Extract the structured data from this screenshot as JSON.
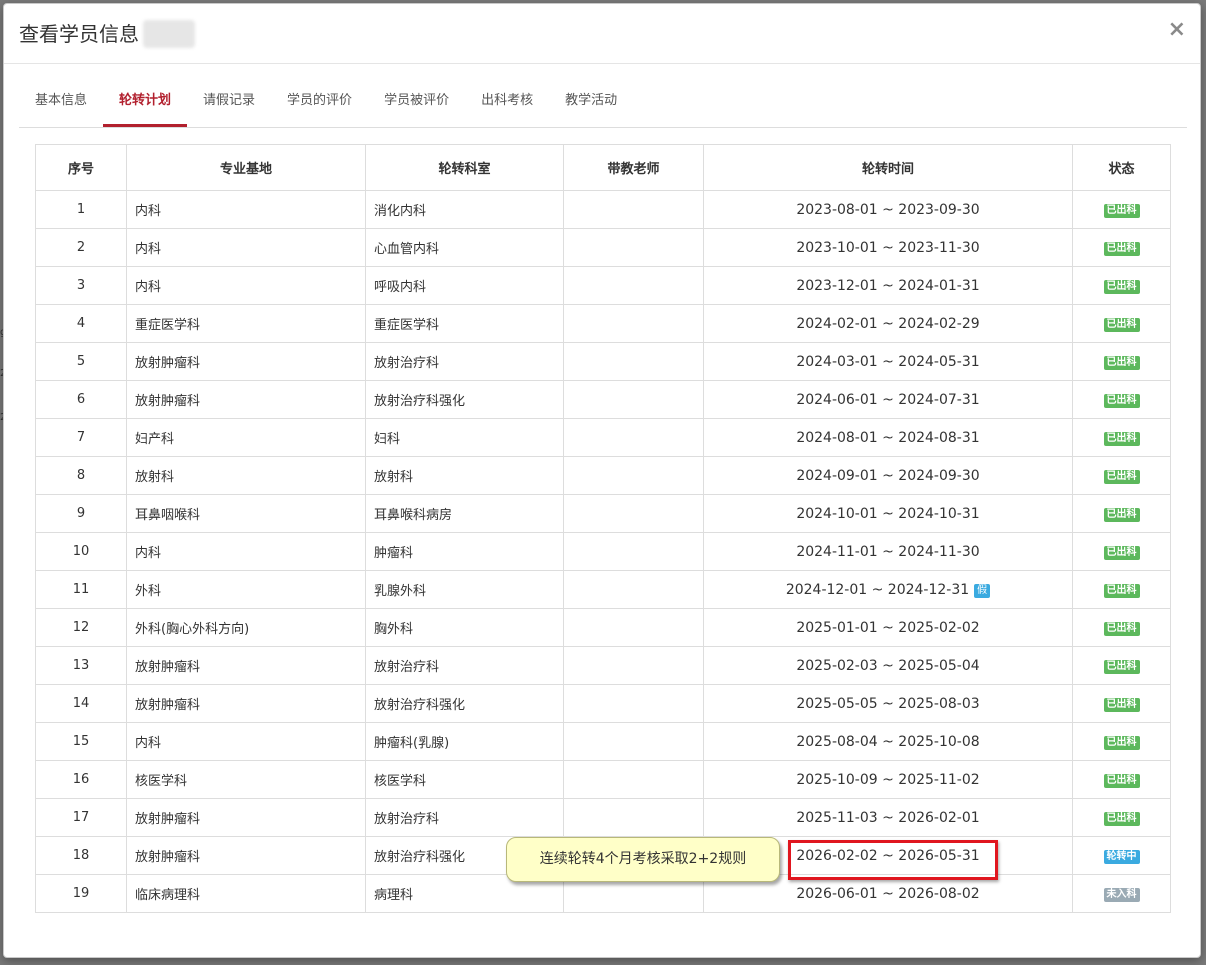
{
  "dialog": {
    "title": "查看学员信息",
    "close_label": "×"
  },
  "tabs": [
    {
      "label": "基本信息",
      "active": false
    },
    {
      "label": "轮转计划",
      "active": true
    },
    {
      "label": "请假记录",
      "active": false
    },
    {
      "label": "学员的评价",
      "active": false
    },
    {
      "label": "学员被评价",
      "active": false
    },
    {
      "label": "出科考核",
      "active": false
    },
    {
      "label": "教学活动",
      "active": false
    }
  ],
  "table": {
    "headers": [
      "序号",
      "专业基地",
      "轮转科室",
      "带教老师",
      "轮转时间",
      "状态"
    ],
    "rows": [
      {
        "no": "1",
        "base": "内科",
        "dept": "消化内科",
        "teacher": "",
        "time": "2023-08-01 ~ 2023-09-30",
        "status": "已出科",
        "leave": ""
      },
      {
        "no": "2",
        "base": "内科",
        "dept": "心血管内科",
        "teacher": "",
        "time": "2023-10-01 ~ 2023-11-30",
        "status": "已出科",
        "leave": ""
      },
      {
        "no": "3",
        "base": "内科",
        "dept": "呼吸内科",
        "teacher": "",
        "time": "2023-12-01 ~ 2024-01-31",
        "status": "已出科",
        "leave": ""
      },
      {
        "no": "4",
        "base": "重症医学科",
        "dept": "重症医学科",
        "teacher": "",
        "time": "2024-02-01 ~ 2024-02-29",
        "status": "已出科",
        "leave": ""
      },
      {
        "no": "5",
        "base": "放射肿瘤科",
        "dept": "放射治疗科",
        "teacher": "",
        "time": "2024-03-01 ~ 2024-05-31",
        "status": "已出科",
        "leave": ""
      },
      {
        "no": "6",
        "base": "放射肿瘤科",
        "dept": "放射治疗科强化",
        "teacher": "",
        "time": "2024-06-01 ~ 2024-07-31",
        "status": "已出科",
        "leave": ""
      },
      {
        "no": "7",
        "base": "妇产科",
        "dept": "妇科",
        "teacher": "",
        "time": "2024-08-01 ~ 2024-08-31",
        "status": "已出科",
        "leave": ""
      },
      {
        "no": "8",
        "base": "放射科",
        "dept": "放射科",
        "teacher": "",
        "time": "2024-09-01 ~ 2024-09-30",
        "status": "已出科",
        "leave": ""
      },
      {
        "no": "9",
        "base": "耳鼻咽喉科",
        "dept": "耳鼻喉科病房",
        "teacher": "",
        "time": "2024-10-01 ~ 2024-10-31",
        "status": "已出科",
        "leave": ""
      },
      {
        "no": "10",
        "base": "内科",
        "dept": "肿瘤科",
        "teacher": "",
        "time": "2024-11-01 ~ 2024-11-30",
        "status": "已出科",
        "leave": ""
      },
      {
        "no": "11",
        "base": "外科",
        "dept": "乳腺外科",
        "teacher": "",
        "time": "2024-12-01 ~ 2024-12-31",
        "status": "已出科",
        "leave": "假"
      },
      {
        "no": "12",
        "base": "外科(胸心外科方向)",
        "dept": "胸外科",
        "teacher": "",
        "time": "2025-01-01 ~ 2025-02-02",
        "status": "已出科",
        "leave": ""
      },
      {
        "no": "13",
        "base": "放射肿瘤科",
        "dept": "放射治疗科",
        "teacher": "",
        "time": "2025-02-03 ~ 2025-05-04",
        "status": "已出科",
        "leave": ""
      },
      {
        "no": "14",
        "base": "放射肿瘤科",
        "dept": "放射治疗科强化",
        "teacher": "",
        "time": "2025-05-05 ~ 2025-08-03",
        "status": "已出科",
        "leave": ""
      },
      {
        "no": "15",
        "base": "内科",
        "dept": "肿瘤科(乳腺)",
        "teacher": "",
        "time": "2025-08-04 ~ 2025-10-08",
        "status": "已出科",
        "leave": ""
      },
      {
        "no": "16",
        "base": "核医学科",
        "dept": "核医学科",
        "teacher": "",
        "time": "2025-10-09 ~ 2025-11-02",
        "status": "已出科",
        "leave": ""
      },
      {
        "no": "17",
        "base": "放射肿瘤科",
        "dept": "放射治疗科",
        "teacher": "",
        "time": "2025-11-03 ~ 2026-02-01",
        "status": "已出科",
        "leave": ""
      },
      {
        "no": "18",
        "base": "放射肿瘤科",
        "dept": "放射治疗科强化",
        "teacher": "",
        "time": "2026-02-02 ~ 2026-05-31",
        "status": "轮转中",
        "leave": ""
      },
      {
        "no": "19",
        "base": "临床病理科",
        "dept": "病理科",
        "teacher": "",
        "time": "2026-06-01 ~ 2026-08-02",
        "status": "未入科",
        "leave": ""
      }
    ]
  },
  "status_colors": {
    "已出科": "#5cb85c",
    "轮转中": "#3aaae0",
    "未入科": "#9aaab4"
  },
  "annotation": {
    "callout_text": "连续轮转4个月考核采取2+2规则",
    "highlight_color": "#e0161f"
  },
  "background_fragments": [
    "g",
    "2",
    "2"
  ]
}
